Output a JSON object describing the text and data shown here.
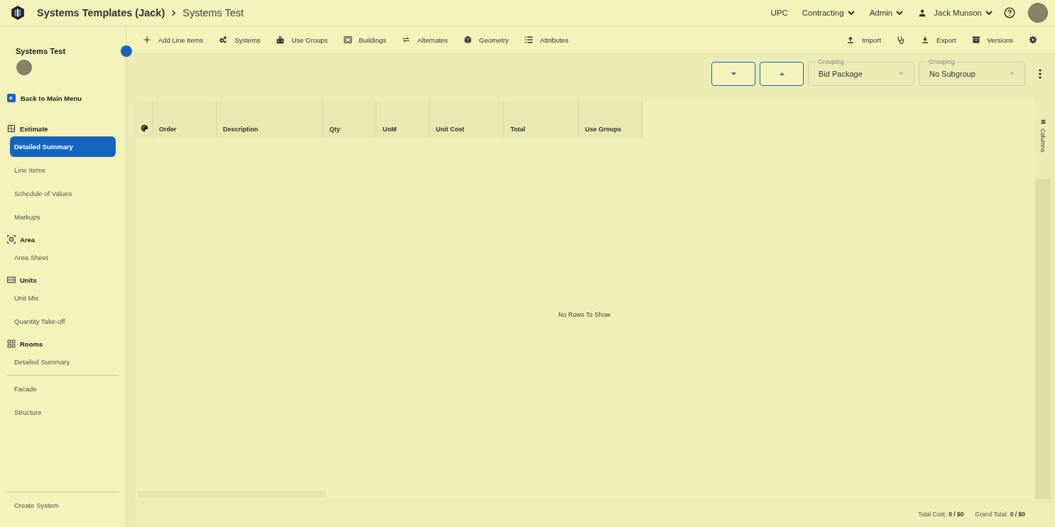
{
  "header": {
    "breadcrumb": [
      {
        "label": "Systems Templates (Jack)",
        "current": false
      },
      {
        "label": "Systems Test",
        "current": true
      }
    ],
    "nav": [
      {
        "label": "UPC",
        "kind": "link"
      },
      {
        "label": "Contracting",
        "kind": "menu"
      },
      {
        "label": "Admin",
        "kind": "menu"
      },
      {
        "label": "Jack Munson",
        "kind": "user"
      }
    ]
  },
  "sidebar": {
    "title": "Systems Test",
    "back": "Back to Main Menu",
    "sections": [
      {
        "label": "Estimate",
        "items": [
          {
            "label": "Detailed Summary",
            "selected": true
          },
          {
            "label": "Line Items",
            "selected": false
          },
          {
            "label": "Schedule of Values",
            "selected": false
          },
          {
            "label": "Markups",
            "selected": false
          }
        ]
      },
      {
        "label": "Area",
        "items": [
          {
            "label": "Area Sheet",
            "selected": false
          }
        ]
      },
      {
        "label": "Units",
        "items": [
          {
            "label": "Unit Mix",
            "selected": false
          },
          {
            "label": "Quantity Take-off",
            "selected": false
          }
        ]
      },
      {
        "label": "Rooms",
        "items": [
          {
            "label": "Detailed Summary",
            "selected": false
          }
        ]
      }
    ],
    "extra": [
      {
        "label": "Facade",
        "selected": false
      },
      {
        "label": "Structure",
        "selected": false
      }
    ],
    "footer": "Create System"
  },
  "toolbar": {
    "left": [
      {
        "label": "Add Line Items"
      },
      {
        "label": "Systems"
      },
      {
        "label": "Use Groups"
      },
      {
        "label": "Buildings"
      },
      {
        "label": "Alternates"
      },
      {
        "label": "Geometry"
      },
      {
        "label": "Attributes"
      }
    ],
    "right": [
      {
        "kind": "labeled",
        "label": "Import"
      },
      {
        "kind": "icon"
      },
      {
        "kind": "labeled",
        "label": "Export"
      },
      {
        "kind": "labeled",
        "label": "Versions"
      },
      {
        "kind": "icon"
      }
    ]
  },
  "controls": {
    "buttons": [
      {
        "kind": "expand"
      },
      {
        "kind": "collapse"
      }
    ],
    "groupings": [
      {
        "label": "Grouping",
        "value": "Bid Package"
      },
      {
        "label": "Grouping",
        "value": "No Subgroup"
      }
    ]
  },
  "grid": {
    "columns": [
      {
        "label": "Order"
      },
      {
        "label": "Description"
      },
      {
        "label": "Qty"
      },
      {
        "label": "UoM"
      },
      {
        "label": "Unit Cost"
      },
      {
        "label": "Total"
      },
      {
        "label": "Use Groups"
      }
    ],
    "empty_message": "No Rows To Show",
    "side_panel": "Columns"
  },
  "footer": {
    "total_cost_label": "Total Cost:",
    "total_cost": "0 / $0",
    "grand_total_label": "Grand Total:",
    "grand_total": "0 / $0"
  }
}
